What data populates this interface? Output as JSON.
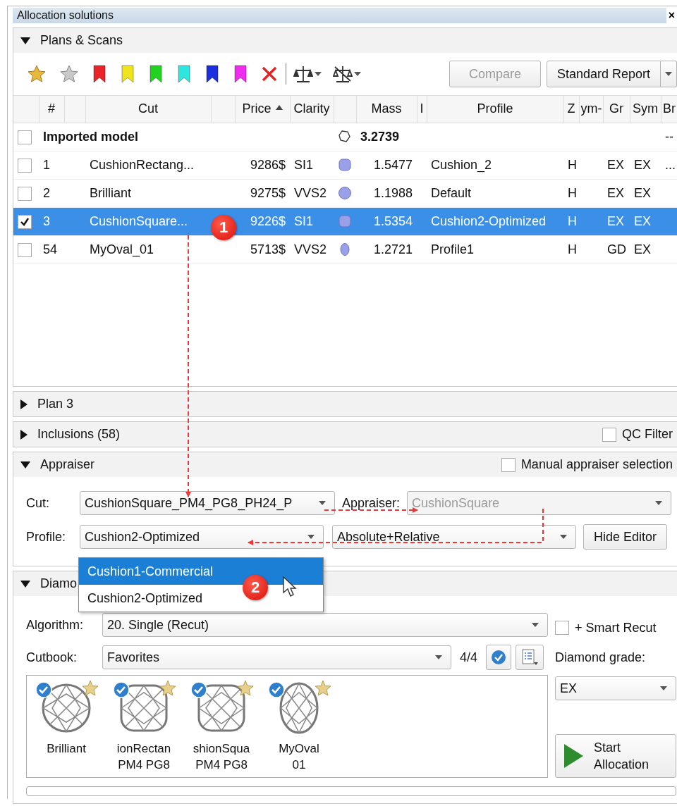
{
  "window": {
    "title": "Allocation solutions",
    "close": "×"
  },
  "plans_panel": {
    "title": "Plans & Scans",
    "expanded": true,
    "toolbar": {
      "flags": [
        {
          "color": "#e8242a"
        },
        {
          "color": "#f0e41c"
        },
        {
          "color": "#1fd31f"
        },
        {
          "color": "#2ee6e0"
        },
        {
          "color": "#1c2fe0"
        },
        {
          "color": "#f02cf0"
        }
      ],
      "compare": {
        "label": "Compare",
        "disabled": true
      },
      "report": {
        "label": "Standard Report"
      }
    },
    "table": {
      "columns": [
        {
          "sort_ascending": false
        },
        {
          "label": "#",
          "sort_ascending": false
        },
        {
          "sort_ascending": false
        },
        {
          "label": "Cut",
          "sort_ascending": false
        },
        {
          "sort_ascending": false
        },
        {
          "label": "Price",
          "sort_ascending": true
        },
        {
          "label": "Clarity",
          "sort_ascending": false
        },
        {
          "sort_ascending": false
        },
        {
          "label": "Mass",
          "sort_ascending": false
        },
        {
          "label": "I",
          "sort_ascending": false
        },
        {
          "label": "Profile",
          "sort_ascending": false
        },
        {
          "label": "Z",
          "sort_ascending": false
        },
        {
          "label": "ym-",
          "sort_ascending": false
        },
        {
          "label": "Gr",
          "sort_ascending": false
        },
        {
          "label": "Sym",
          "sort_ascending": false
        },
        {
          "label": "Br",
          "sort_ascending": false
        }
      ],
      "rows": [
        {
          "kind": "polygon",
          "checked": false,
          "selected": false,
          "name": "Imported model",
          "mass": "3.2739",
          "br": "--"
        },
        {
          "kind": "cushion",
          "checked": false,
          "selected": false,
          "number": "1",
          "cut": "CushionRectang...",
          "price": "9286$",
          "clarity": "SI1",
          "mass": "1.5477",
          "profile": "Cushion_2",
          "dz": "H",
          "gr": "EX",
          "sym": "EX",
          "br": "..."
        },
        {
          "kind": "round",
          "checked": false,
          "selected": false,
          "number": "2",
          "cut": "Brilliant",
          "price": "9275$",
          "clarity": "VVS2",
          "mass": "1.1988",
          "profile": "Default",
          "dz": "H",
          "gr": "EX",
          "sym": "EX"
        },
        {
          "kind": "cushion",
          "checked": true,
          "selected": true,
          "number": "3",
          "cut": "CushionSquare...",
          "price": "9226$",
          "clarity": "SI1",
          "mass": "1.5354",
          "profile": "Cushion2-Optimized",
          "dz": "H",
          "gr": "EX",
          "sym": "EX"
        },
        {
          "kind": "oval",
          "checked": false,
          "selected": false,
          "number": "54",
          "cut": "MyOval_01",
          "price": "5713$",
          "clarity": "VVS2",
          "mass": "1.2721",
          "profile": "Profile1",
          "dz": "H",
          "gr": "GD",
          "sym": "EX"
        }
      ]
    }
  },
  "plan_panel": {
    "title": "Plan 3",
    "expanded": false
  },
  "inclusions_panel": {
    "title": "Inclusions (58)",
    "expanded": false,
    "qc_filter": {
      "label": "QC Filter",
      "checked": false
    }
  },
  "appraiser_panel": {
    "title": "Appraiser",
    "expanded": true,
    "manual": {
      "label": "Manual appraiser selection",
      "checked": false
    },
    "cut_label": "Cut:",
    "cut_value": "CushionSquare_PM4_PG8_PH24_P",
    "appraiser_label": "Appraiser:",
    "appraiser_value": "CushionSquare",
    "appraiser_disabled": true,
    "profile_label": "Profile:",
    "profile_value": "Cushion2-Optimized",
    "mode_value": "Absolute+Relative",
    "hide_button": "Hide Editor"
  },
  "diamond_panel": {
    "title": "Diamo",
    "expanded": true,
    "algorithm_label": "Algorithm:",
    "algorithm_value": "20. Single (Recut)",
    "smart_recut": {
      "label": "+ Smart Recut",
      "checked": false
    },
    "cutbook_label": "Cutbook:",
    "cutbook_value": "Favorites",
    "count": "4/4",
    "grade_label": "Diamond grade:",
    "grade_value": "EX",
    "cuts": [
      {
        "kind": "round",
        "checked": true,
        "favorite": true,
        "lines": [
          "Brilliant"
        ]
      },
      {
        "kind": "cushion",
        "checked": true,
        "favorite": true,
        "lines": [
          "ionRectan",
          "PM4 PG8"
        ]
      },
      {
        "kind": "cushion",
        "checked": true,
        "favorite": true,
        "lines": [
          "shionSqua",
          "PM4 PG8"
        ]
      },
      {
        "kind": "oval",
        "checked": true,
        "favorite": true,
        "lines": [
          "MyOval",
          "01"
        ]
      }
    ],
    "progress": {
      "level": 0
    },
    "start_button": [
      "Start",
      "Allocation"
    ]
  },
  "profile_dropdown": {
    "options": [
      {
        "label": "Cushion1-Commercial",
        "selected": true
      },
      {
        "label": "Cushion2-Optimized",
        "selected": false
      }
    ]
  },
  "annotations": [
    {
      "label": "1"
    },
    {
      "label": "2"
    }
  ]
}
